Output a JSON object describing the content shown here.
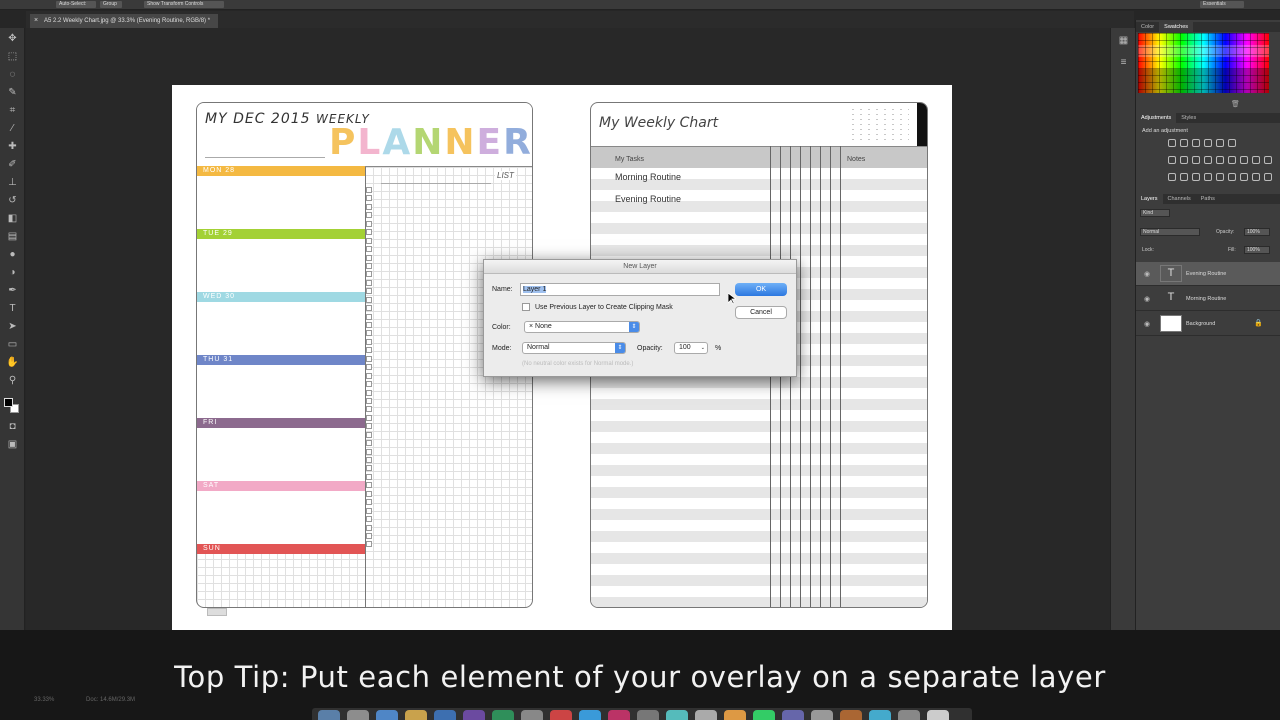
{
  "app": {
    "options_bar": [
      "Auto-Select:",
      "Group",
      "Show Transform Controls"
    ],
    "workspace": "Essentials",
    "doc_tab": "A5 2.2 Weekly Chart.jpg @ 33.3% (Evening Routine, RGB/8) *",
    "doc_tab_close": "×"
  },
  "planner": {
    "my_dec": "MY DEC 2015",
    "weekly": "WEEKLY",
    "planner_letters": [
      "P",
      "L",
      "A",
      "N",
      "N",
      "E",
      "R"
    ],
    "planner_colors": [
      "#f4b942",
      "#f2a9c6",
      "#9fd3e6",
      "#a7cf5b",
      "#f4b942",
      "#c6a0d8",
      "#7f9fd6"
    ],
    "list_label": "LIST",
    "days": [
      {
        "label": "MON   28",
        "color": "#f4b942"
      },
      {
        "label": "TUE   29",
        "color": "#a3d135"
      },
      {
        "label": "WED   30",
        "color": "#9fd9e3"
      },
      {
        "label": "THU   31",
        "color": "#6f86c8"
      },
      {
        "label": "FRI",
        "color": "#8c6a8e"
      },
      {
        "label": "SAT",
        "color": "#f2a9c6"
      },
      {
        "label": "SUN",
        "color": "#e25555"
      }
    ]
  },
  "chart": {
    "title": "My Weekly Chart",
    "tasks_header": "My Tasks",
    "notes_header": "Notes",
    "tasks": [
      "Morning Routine",
      "Evening Routine"
    ]
  },
  "dialog": {
    "title": "New Layer",
    "name_label": "Name:",
    "name_value": "Layer 1",
    "clipping_label": "Use Previous Layer to Create Clipping Mask",
    "color_label": "Color:",
    "color_value": "× None",
    "mode_label": "Mode:",
    "mode_value": "Normal",
    "opacity_label": "Opacity:",
    "opacity_value": "100",
    "opacity_unit": "%",
    "ok": "OK",
    "cancel": "Cancel",
    "neutral_label": "(No neutral color exists for Normal mode.)"
  },
  "panels": {
    "color_tabs": [
      "Color",
      "Swatches"
    ],
    "adj_tabs": [
      "Adjustments",
      "Styles"
    ],
    "add_adjustment": "Add an adjustment",
    "layer_tabs": [
      "Layers",
      "Channels",
      "Paths"
    ],
    "kind": "Kind",
    "blend_mode": "Normal",
    "opacity_label": "Opacity:",
    "opacity_value": "100%",
    "lock_label": "Lock:",
    "fill_label": "Fill:",
    "fill_value": "100%",
    "layers": [
      {
        "name": "Evening Routine",
        "type": "T"
      },
      {
        "name": "Morning Routine",
        "type": "T"
      },
      {
        "name": "Background",
        "type": ""
      }
    ]
  },
  "status": {
    "zoom": "33.33%",
    "doc": "Doc: 14.6M/29.3M"
  },
  "caption": "Top Tip: Put each element of your overlay on a separate layer",
  "colors": {
    "accent": "#2c78e0",
    "ui_dark": "#262626",
    "panel": "#3d3d3d"
  }
}
